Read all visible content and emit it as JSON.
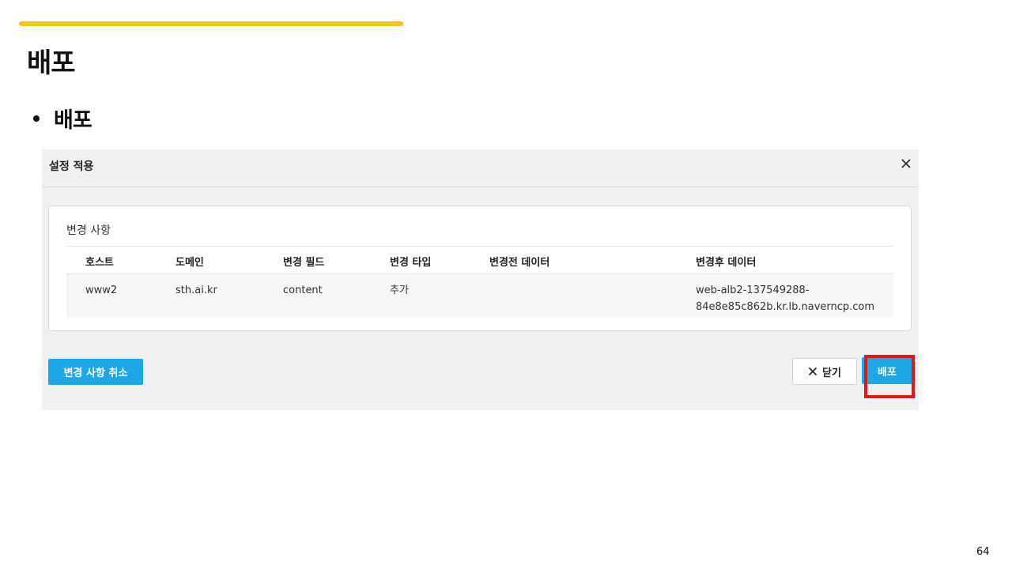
{
  "slide": {
    "title": "배포",
    "bullet": "배포",
    "page_number": "64",
    "accent_color": "#f5c518"
  },
  "dialog": {
    "title": "설정 적용",
    "close_icon": "close-icon",
    "panel": {
      "title": "변경 사항",
      "columns": [
        "호스트",
        "도메인",
        "변경 필드",
        "변경 타입",
        "변경전 데이터",
        "변경후 데이터"
      ],
      "rows": [
        [
          "www2",
          "sth.ai.kr",
          "content",
          "추가",
          "",
          "web-alb2-137549288-84e8e85c862b.kr.lb.naverncp.com"
        ]
      ]
    },
    "buttons": {
      "cancel_changes": "변경 사항 취소",
      "close": "닫기",
      "deploy": "배포"
    },
    "button_color": "#1ea7e6",
    "highlight_color": "#e3161c"
  }
}
